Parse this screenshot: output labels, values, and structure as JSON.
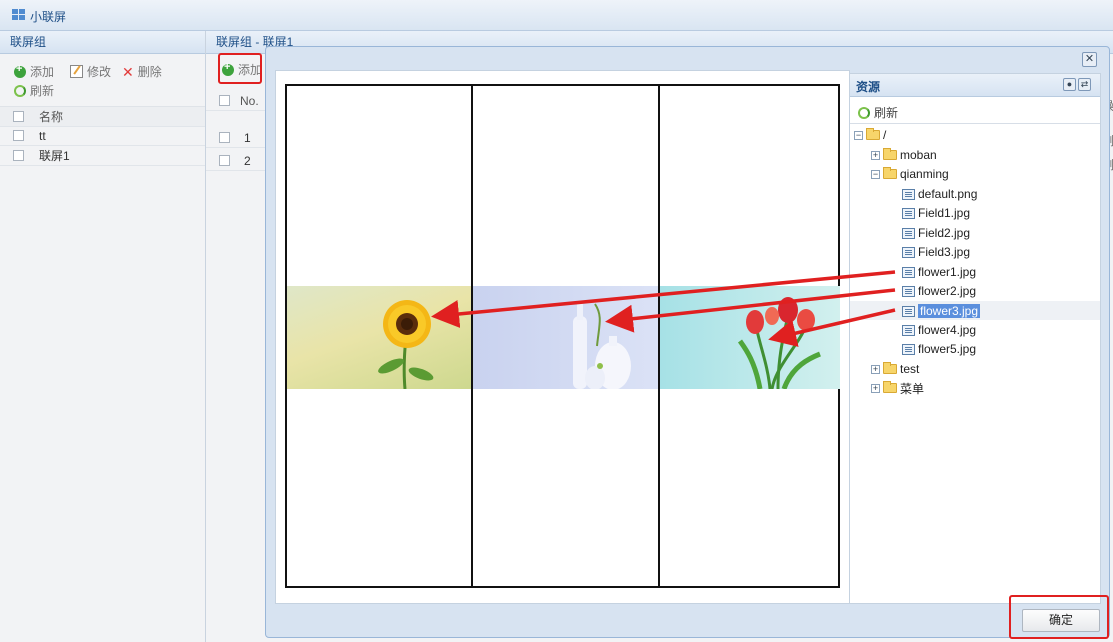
{
  "app": {
    "title": "小联屏"
  },
  "left_panel": {
    "header": "联屏组",
    "toolbar": {
      "add": "添加",
      "edit": "修改",
      "delete": "删除",
      "refresh": "刷新"
    },
    "column_name": "名称",
    "rows": [
      {
        "name": "tt"
      },
      {
        "name": "联屏1"
      }
    ]
  },
  "mid_panel": {
    "header": "联屏组 - 联屏1",
    "toolbar": {
      "add": "添加"
    },
    "column_no": "No.",
    "rows": [
      {
        "no": "1"
      },
      {
        "no": "2"
      }
    ],
    "right_clip_header": "操",
    "right_clip_row": "删"
  },
  "dialog": {
    "close_icon": "close-icon",
    "ok_label": "确定",
    "resource_panel": {
      "title": "资源",
      "refresh": "刷新",
      "tree": [
        {
          "label": "/",
          "type": "folder",
          "expanded": true,
          "depth": 0
        },
        {
          "label": "moban",
          "type": "folder",
          "expanded": false,
          "depth": 1
        },
        {
          "label": "qianming",
          "type": "folder",
          "expanded": true,
          "depth": 1
        },
        {
          "label": "default.png",
          "type": "file",
          "depth": 2
        },
        {
          "label": "Field1.jpg",
          "type": "file",
          "depth": 2
        },
        {
          "label": "Field2.jpg",
          "type": "file",
          "depth": 2
        },
        {
          "label": "Field3.jpg",
          "type": "file",
          "depth": 2
        },
        {
          "label": "flower1.jpg",
          "type": "file",
          "depth": 2
        },
        {
          "label": "flower2.jpg",
          "type": "file",
          "depth": 2
        },
        {
          "label": "flower3.jpg",
          "type": "file",
          "depth": 2,
          "selected": true
        },
        {
          "label": "flower4.jpg",
          "type": "file",
          "depth": 2
        },
        {
          "label": "flower5.jpg",
          "type": "file",
          "depth": 2
        },
        {
          "label": "test",
          "type": "folder",
          "expanded": false,
          "depth": 1
        },
        {
          "label": "菜单",
          "type": "folder",
          "expanded": false,
          "depth": 1
        }
      ]
    }
  },
  "colors": {
    "accent": "#1e4f87",
    "selection": "#5b8fdd",
    "annotation": "#e02020"
  }
}
